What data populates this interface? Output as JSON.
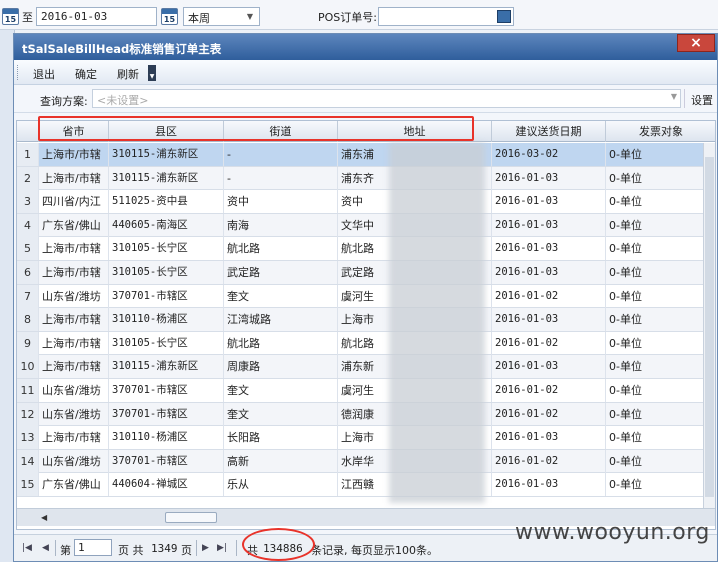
{
  "filter": {
    "to_label": "至",
    "date_to": "2016-01-03",
    "calendar_day": "15",
    "week_option": "本周",
    "pos_label": "POS订单号:"
  },
  "dialog": {
    "title": "tSalSaleBillHead标准销售订单主表",
    "close_label": "×",
    "toolbar": {
      "back": "退出",
      "confirm": "确定",
      "refresh": "刷新"
    },
    "query": {
      "label": "查询方案:",
      "placeholder": "<未设置>",
      "settings": "设置"
    }
  },
  "grid": {
    "columns": [
      "省市",
      "县区",
      "街道",
      "地址",
      "建议送货日期",
      "发票对象"
    ],
    "rows": [
      {
        "n": "1",
        "city": "上海市/市辖",
        "district": "310115-浦东新区",
        "street": "-",
        "addr": "浦东浦",
        "date": "2016-03-02",
        "invoice": "0-单位",
        "selected": true
      },
      {
        "n": "2",
        "city": "上海市/市辖",
        "district": "310115-浦东新区",
        "street": "-",
        "addr": "浦东齐",
        "date": "2016-01-03",
        "invoice": "0-单位"
      },
      {
        "n": "3",
        "city": "四川省/内江",
        "district": "511025-资中县",
        "street": "资中",
        "addr": "资中",
        "date": "2016-01-03",
        "invoice": "0-单位"
      },
      {
        "n": "4",
        "city": "广东省/佛山",
        "district": "440605-南海区",
        "street": "南海",
        "addr": "文华中",
        "date": "2016-01-03",
        "invoice": "0-单位"
      },
      {
        "n": "5",
        "city": "上海市/市辖",
        "district": "310105-长宁区",
        "street": "航北路",
        "addr": "航北路",
        "date": "2016-01-03",
        "invoice": "0-单位"
      },
      {
        "n": "6",
        "city": "上海市/市辖",
        "district": "310105-长宁区",
        "street": "武定路",
        "addr": "武定路",
        "date": "2016-01-03",
        "invoice": "0-单位"
      },
      {
        "n": "7",
        "city": "山东省/潍坊",
        "district": "370701-市辖区",
        "street": "奎文",
        "addr": "虞河生",
        "date": "2016-01-02",
        "invoice": "0-单位"
      },
      {
        "n": "8",
        "city": "上海市/市辖",
        "district": "310110-杨浦区",
        "street": "江湾城路",
        "addr": "上海市",
        "date": "2016-01-03",
        "invoice": "0-单位"
      },
      {
        "n": "9",
        "city": "上海市/市辖",
        "district": "310105-长宁区",
        "street": "航北路",
        "addr": "航北路",
        "date": "2016-01-02",
        "invoice": "0-单位"
      },
      {
        "n": "10",
        "city": "上海市/市辖",
        "district": "310115-浦东新区",
        "street": "周康路",
        "addr": "浦东新",
        "date": "2016-01-03",
        "invoice": "0-单位"
      },
      {
        "n": "11",
        "city": "山东省/潍坊",
        "district": "370701-市辖区",
        "street": "奎文",
        "addr": "虞河生",
        "date": "2016-01-02",
        "invoice": "0-单位"
      },
      {
        "n": "12",
        "city": "山东省/潍坊",
        "district": "370701-市辖区",
        "street": "奎文",
        "addr": "德润康",
        "date": "2016-01-02",
        "invoice": "0-单位"
      },
      {
        "n": "13",
        "city": "上海市/市辖",
        "district": "310110-杨浦区",
        "street": "长阳路",
        "addr": "上海市",
        "date": "2016-01-03",
        "invoice": "0-单位"
      },
      {
        "n": "14",
        "city": "山东省/潍坊",
        "district": "370701-市辖区",
        "street": "高新",
        "addr": "水岸华",
        "date": "2016-01-02",
        "invoice": "0-单位"
      },
      {
        "n": "15",
        "city": "广东省/佛山",
        "district": "440604-禅城区",
        "street": "乐从",
        "addr": "江西赣",
        "date": "2016-01-03",
        "invoice": "0-单位"
      }
    ]
  },
  "pager": {
    "page_prefix": "第",
    "page_value": "1",
    "page_mid": "页 共",
    "total_pages": "1349",
    "page_suffix": "页",
    "total_prefix": "共",
    "total_records": "134886",
    "total_suffix": "条记录, 每页显示100条。"
  },
  "watermark": "www.wooyun.org"
}
